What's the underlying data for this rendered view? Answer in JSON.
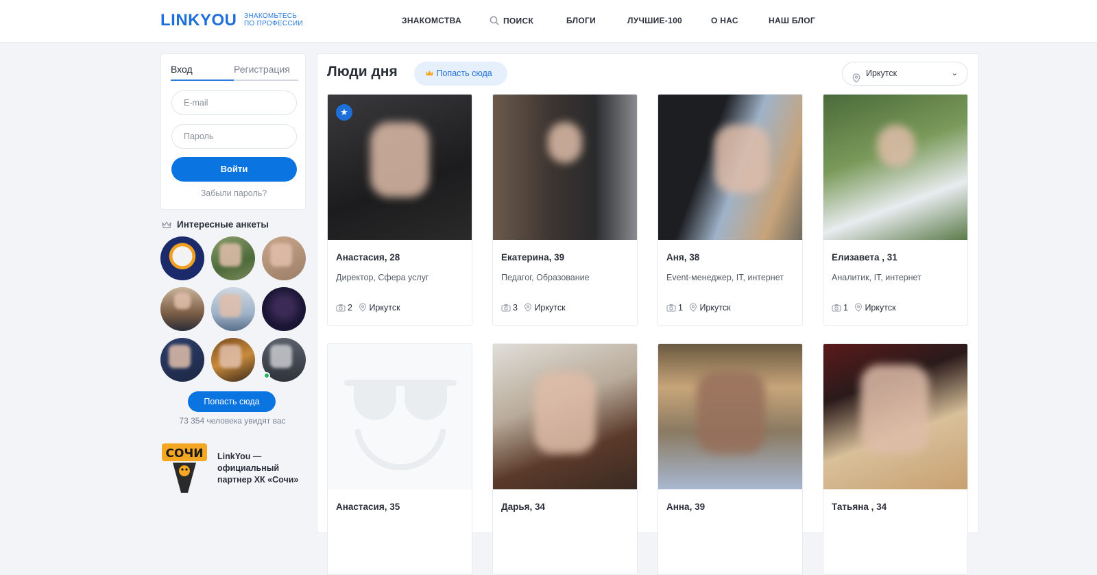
{
  "header": {
    "logo": "LINKYOU",
    "tagline_line1": "ЗНАКОМЬТЕСЬ",
    "tagline_line2": "ПО ПРОФЕССИИ",
    "nav": [
      "ЗНАКОМСТВА",
      "ПОИСК",
      "БЛОГИ",
      "ЛУЧШИЕ-100",
      "О НАС",
      "НАШ БЛОГ"
    ]
  },
  "login": {
    "tab_login": "Вход",
    "tab_register": "Регистрация",
    "email_placeholder": "E-mail",
    "password_placeholder": "Пароль",
    "submit": "Войти",
    "forgot": "Забыли пароль?"
  },
  "interesting": {
    "title": "Интересные анкеты",
    "button": "Попасть сюда",
    "viewers": "73 354 человека увидят вас"
  },
  "partner": {
    "logo_text": "СОЧИ",
    "text": "LinkYou — официальный партнер ХК «Сочи»"
  },
  "main": {
    "title": "Люди дня",
    "button": "Попасть сюда",
    "city": "Иркутск"
  },
  "profiles": [
    {
      "name": "Анастасия, 28",
      "profession": "Директор, Сфера услуг",
      "photos": "2",
      "city": "Иркутск"
    },
    {
      "name": "Екатерина, 39",
      "profession": "Педагог, Образование",
      "photos": "3",
      "city": "Иркутск"
    },
    {
      "name": "Аня, 38",
      "profession": "Event-менеджер, IT, интернет",
      "photos": "1",
      "city": "Иркутск"
    },
    {
      "name": "Елизавета , 31",
      "profession": "Аналитик, IT, интернет",
      "photos": "1",
      "city": "Иркутск"
    },
    {
      "name": "Анастасия, 35"
    },
    {
      "name": "Дарья, 34"
    },
    {
      "name": "Анна, 39"
    },
    {
      "name": "Татьяна , 34"
    }
  ],
  "colors": {
    "accent": "#0a74e0",
    "brand": "#1e6fd9",
    "online": "#22b35e"
  }
}
